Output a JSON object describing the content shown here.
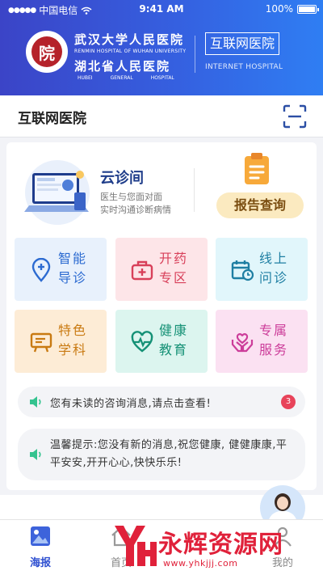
{
  "status_bar": {
    "carrier": "中国电信",
    "time": "9:41 AM",
    "battery": "100%"
  },
  "header": {
    "logo_text": "院",
    "hospital_name_cn": "武汉大学人民医院",
    "hospital_name_en": "RENMIN HOSPITAL OF WUHAN UNIVERSITY",
    "hospital_name2_cn": "湖北省人民医院",
    "hospital_name2_en": [
      "HUBEI",
      "GENERAL",
      "HOSPITAL"
    ],
    "badge": "互联网医院",
    "badge_en": "INTERNET HOSPITAL"
  },
  "titlebar": {
    "title": "互联网医院",
    "scan_icon": "scan-icon"
  },
  "cloud_clinic": {
    "title": "云诊间",
    "line1": "医生与您面对面",
    "line2": "实时沟通诊断病情"
  },
  "report": {
    "label": "报告查询"
  },
  "tiles": [
    {
      "line1": "智能",
      "line2": "导诊",
      "icon": "location-plus-icon",
      "color": "#2c6bd1"
    },
    {
      "line1": "开药",
      "line2": "专区",
      "icon": "medicine-kit-icon",
      "color": "#d8405a"
    },
    {
      "line1": "线上",
      "line2": "问诊",
      "icon": "calendar-clock-icon",
      "color": "#1f7fa3"
    },
    {
      "line1": "特色",
      "line2": "学科",
      "icon": "board-icon",
      "color": "#c97a12"
    },
    {
      "line1": "健康",
      "line2": "教育",
      "icon": "heart-pulse-icon",
      "color": "#159176"
    },
    {
      "line1": "专属",
      "line2": "服务",
      "icon": "hands-heart-icon",
      "color": "#cc3d9a"
    }
  ],
  "notices": {
    "unread": "您有未读的咨询消息,请点击查看!",
    "unread_count": "3",
    "tip": "温馨提示:您没有新的消息,祝您健康, 健健康康,平平安安,开开心心,快快乐乐!"
  },
  "tabs": [
    {
      "label": "海报",
      "icon": "poster-icon"
    },
    {
      "label": "首页",
      "icon": "home-icon"
    },
    {
      "label": "",
      "icon": ""
    },
    {
      "label": "",
      "icon": ""
    },
    {
      "label": "我的",
      "icon": "user-icon"
    }
  ],
  "watermark": {
    "text": "永辉资源网",
    "url": "www.yhkjjj.com"
  }
}
